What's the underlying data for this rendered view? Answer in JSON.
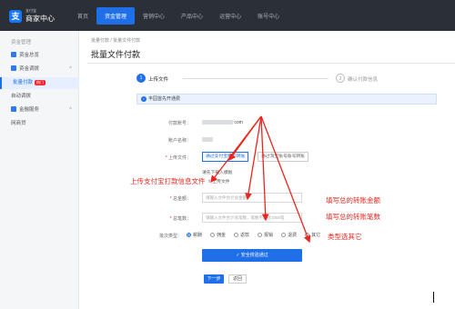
{
  "logo": {
    "mark": "支",
    "text": "商家中心",
    "sub": "支付宝"
  },
  "nav": [
    "首页",
    "资金管理",
    "营销中心",
    "产品中心",
    "运营中心",
    "账号中心"
  ],
  "sidebar": {
    "group_title": "资金管理",
    "items": [
      {
        "label": "资金总览"
      },
      {
        "label": "资金调拨"
      },
      {
        "label": "批量付款",
        "badge": "热门"
      },
      {
        "label": "自动调拨"
      },
      {
        "label": "金融服务"
      },
      {
        "label": "网商贷"
      }
    ]
  },
  "breadcrumb": "批量付款 / 批量文件付款",
  "page_title": "批量文件付款",
  "steps": [
    {
      "num": "1",
      "label": "上传文件"
    },
    {
      "num": "2",
      "label": "确认付款信息"
    }
  ],
  "notice": {
    "icon": "i",
    "text": "丰园首先开通费"
  },
  "form": {
    "payer_account_label": "付款账号：",
    "payer_account_suffix": "com",
    "account_name_label": "账户名称：",
    "upload_label": "上传文件：",
    "upload_tab_1": "通过支付宝账号转账",
    "upload_tab_2": "通过淘宝账号账号转账",
    "template_hint": "请先下载入模板",
    "upload_button": "上传文件",
    "amount_label": "总金额：",
    "amount_placeholder": "请输入文件合计总金额",
    "count_label": "总笔数：",
    "count_placeholder": "请输入文件合计总笔数，笔数不超过1000笔",
    "type_label": "批次类型：",
    "types": [
      "薪酬",
      "佣金",
      "返款",
      "报销",
      "退费",
      "其它"
    ],
    "verify_button": "安全校验通过",
    "next_button": "下一步",
    "back_button": "返回"
  },
  "annotations": {
    "upload": "上传支付宝打款信息文件",
    "amount": "填写总的转账金额",
    "count": "填写总的转账笔数",
    "type": "类型选其它"
  },
  "colors": {
    "accent": "#1e6fe8",
    "annotation": "#e8261f",
    "topbar": "#2b3036"
  }
}
